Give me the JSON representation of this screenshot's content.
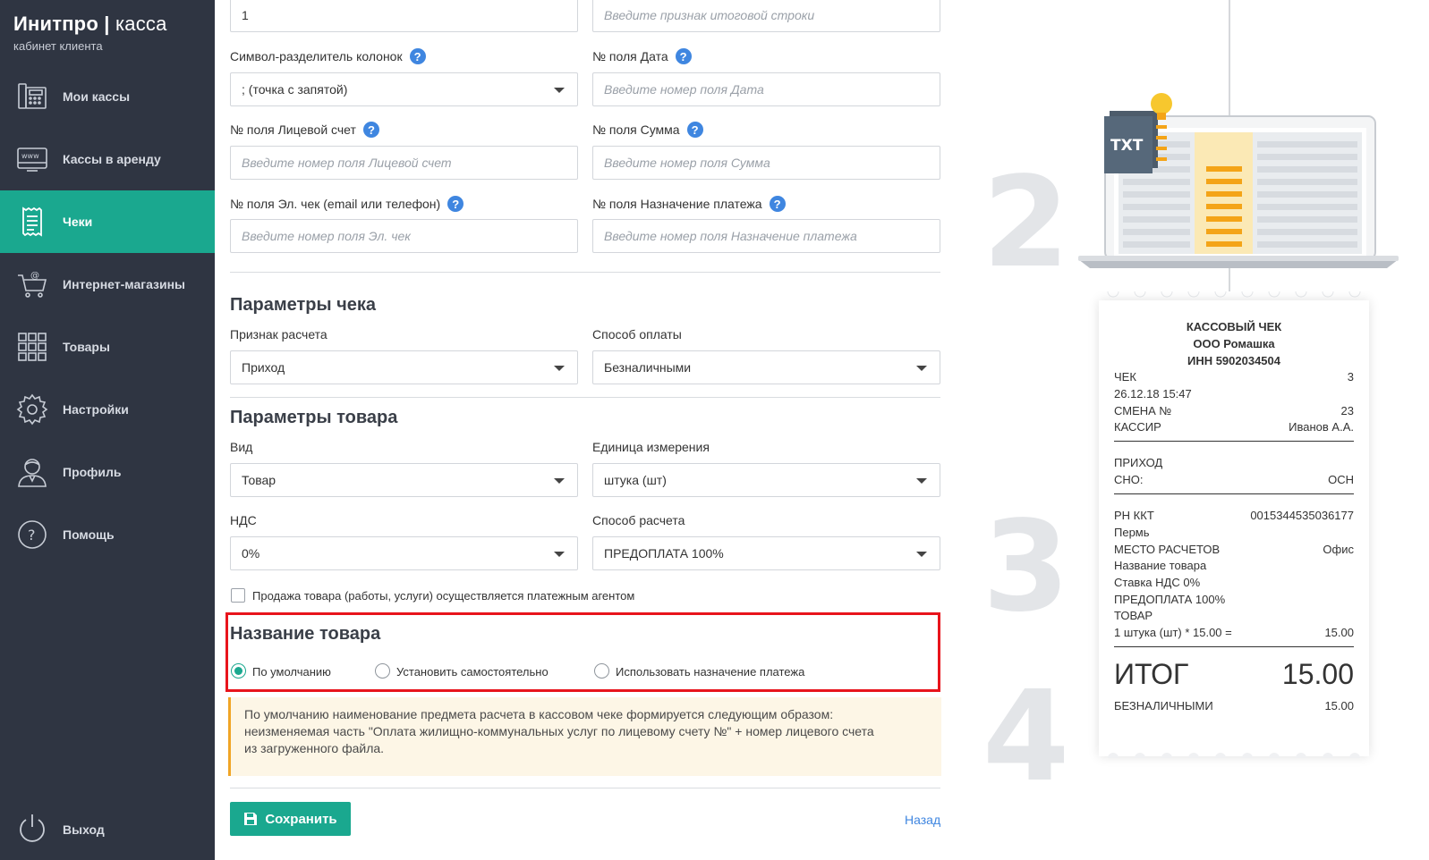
{
  "brand": {
    "name": "Инитпро",
    "product": "касса",
    "subtitle": "кабинет клиента"
  },
  "sidebar": {
    "items": [
      {
        "label": "Мои кассы",
        "icon": "cash-register-icon"
      },
      {
        "label": "Кассы в аренду",
        "icon": "www-terminal-icon"
      },
      {
        "label": "Чеки",
        "icon": "receipt-icon",
        "active": true
      },
      {
        "label": "Интернет-магазины",
        "icon": "cart-icon"
      },
      {
        "label": "Товары",
        "icon": "grid-icon"
      },
      {
        "label": "Настройки",
        "icon": "gear-icon"
      },
      {
        "label": "Профиль",
        "icon": "user-icon"
      },
      {
        "label": "Помощь",
        "icon": "question-icon"
      }
    ],
    "logout_label": "Выход"
  },
  "form": {
    "top_left_value": "1",
    "top_right_placeholder": "Введите признак итоговой строки",
    "separator": {
      "label": "Символ-разделитель колонок",
      "value": "; (точка с запятой)"
    },
    "date_field": {
      "label": "№ поля Дата",
      "placeholder": "Введите номер поля Дата"
    },
    "account_field": {
      "label": "№ поля Лицевой счет",
      "placeholder": "Введите номер поля Лицевой счет"
    },
    "sum_field": {
      "label": "№ поля Сумма",
      "placeholder": "Введите номер поля Сумма"
    },
    "echeck_field": {
      "label": "№ поля Эл. чек (email или телефон)",
      "placeholder": "Введите номер поля Эл. чек"
    },
    "purpose_field": {
      "label": "№ поля Назначение платежа",
      "placeholder": "Введите номер поля Назначение платежа"
    }
  },
  "receipt_params": {
    "title": "Параметры чека",
    "calc_sign": {
      "label": "Признак расчета",
      "value": "Приход"
    },
    "payment_method": {
      "label": "Способ оплаты",
      "value": "Безналичными"
    }
  },
  "product_params": {
    "title": "Параметры товара",
    "kind": {
      "label": "Вид",
      "value": "Товар"
    },
    "unit": {
      "label": "Единица измерения",
      "value": "штука (шт)"
    },
    "vat": {
      "label": "НДС",
      "value": "0%"
    },
    "calc_method": {
      "label": "Способ расчета",
      "value": "ПРЕДОПЛАТА 100%"
    },
    "agent_checkbox_label": "Продажа товара (работы, услуги) осуществляется платежным агентом"
  },
  "product_name": {
    "title": "Название товара",
    "options": [
      "По умолчанию",
      "Установить самостоятельно",
      "Использовать назначение платежа"
    ],
    "selected": "По умолчанию",
    "note_lines": [
      "По умолчанию наименование предмета расчета в кассовом чеке формируется следующим образом:",
      "неизменяемая часть \"Оплата жилищно-коммунальных услуг по лицевому счету №\" + номер лицевого счета",
      "из загруженного файла."
    ]
  },
  "actions": {
    "save_label": "Сохранить",
    "back_label": "Назад"
  },
  "illustration": {
    "file_badge": "TXT",
    "steps": [
      "2",
      "3",
      "4"
    ],
    "receipt": {
      "title": "КАССОВЫЙ ЧЕК",
      "org": "ООО Ромашка",
      "inn": "ИНН 5902034504",
      "check_label": "ЧЕК",
      "check_no": "3",
      "datetime": "26.12.18 15:47",
      "shift_label": "СМЕНА №",
      "shift_no": "23",
      "cashier_label": "КАССИР",
      "cashier": "Иванов А.А.",
      "type": "ПРИХОД",
      "sno_label": "СНО:",
      "sno": "ОСН",
      "rn_label": "РН ККТ",
      "rn": "0015344535036177",
      "city": "Пермь",
      "place_label": "МЕСТО РАСЧЕТОВ",
      "place": "Офис",
      "item_name": "Название товара",
      "vat": "Ставка НДС 0%",
      "prepay": "ПРЕДОПЛАТА 100%",
      "kind": "ТОВАР",
      "qty_line": "1 штука (шт) * 15.00 =",
      "qty_sum": "15.00",
      "total_label": "ИТОГ",
      "total": "15.00",
      "pay_label": "БЕЗНАЛИЧНЫМИ",
      "pay_sum": "15.00"
    }
  },
  "colors": {
    "sidebar": "#2f3542",
    "accent": "#1aa88f",
    "help": "#3f86e0",
    "highlight": "#e8141c",
    "note_bg": "#fdf6e6",
    "note_border": "#f0a526"
  }
}
